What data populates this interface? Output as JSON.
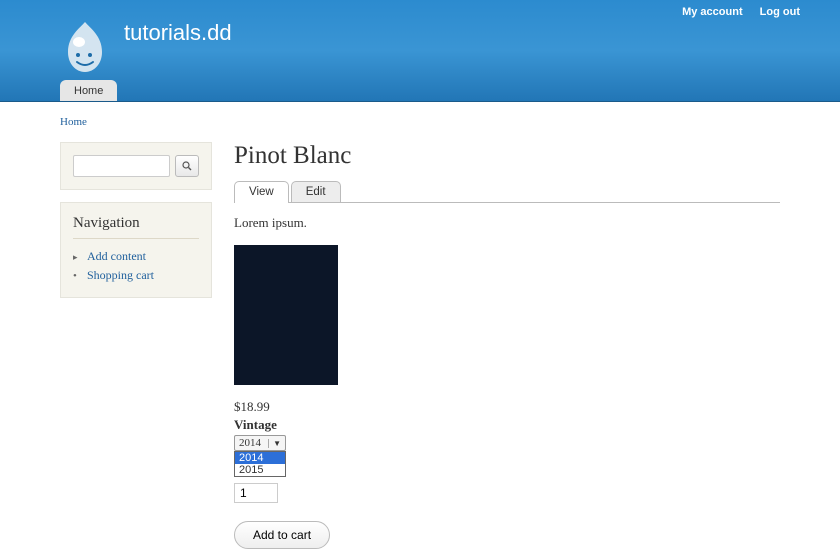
{
  "user_menu": {
    "account": "My account",
    "logout": "Log out"
  },
  "site": {
    "name": "tutorials.dd"
  },
  "main_menu": {
    "home": "Home"
  },
  "breadcrumb": {
    "home": "Home"
  },
  "sidebar": {
    "nav_title": "Navigation",
    "items": [
      {
        "label": "Add content"
      },
      {
        "label": "Shopping cart"
      }
    ]
  },
  "product": {
    "title": "Pinot Blanc",
    "tabs": {
      "view": "View",
      "edit": "Edit"
    },
    "body": "Lorem ipsum.",
    "price": "$18.99",
    "vintage_label": "Vintage",
    "vintage_selected": "2014",
    "vintage_options": [
      "2014",
      "2015"
    ],
    "qty": "1",
    "add_to_cart": "Add to cart"
  }
}
